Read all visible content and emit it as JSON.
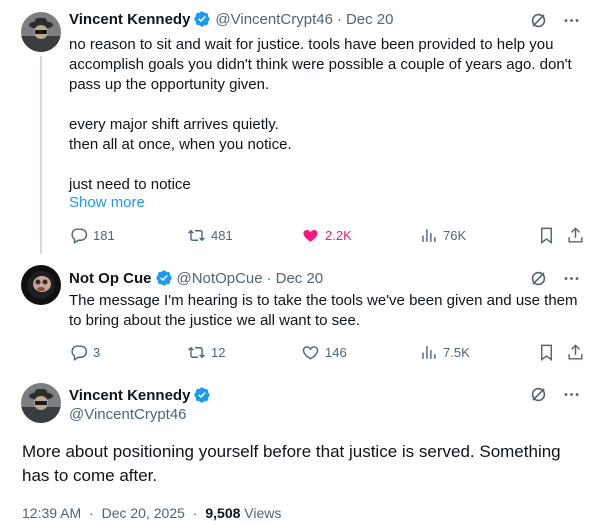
{
  "post1": {
    "name": "Vincent Kennedy",
    "handle": "@VincentCrypt46",
    "separator": "·",
    "date": "Dec 20",
    "text": "no reason to sit and wait for justice. tools have been provided to help you\naccomplish goals you didn't think were possible a couple of years ago. don't\npass up the opportunity given.\n\nevery major shift arrives quietly.\nthen all at once, when you notice.\n\njust need to notice",
    "show_more": "Show more",
    "replies": "181",
    "reposts": "481",
    "likes": "2.2K",
    "views": "76K",
    "like_color": "#f91880"
  },
  "post2": {
    "name": "Not Op Cue",
    "handle": "@NotOpCue",
    "separator": "·",
    "date": "Dec 20",
    "text": "The message I'm hearing is to take the tools we've been given and use them\nto bring about the justice we all want to see.",
    "replies": "3",
    "reposts": "12",
    "likes": "146",
    "views": "7.5K"
  },
  "main": {
    "name": "Vincent Kennedy",
    "handle": "@VincentCrypt46",
    "text": "More about positioning yourself before that justice is served. Something has to come after.",
    "time": "12:39 AM",
    "separator": "·",
    "date": "Dec 20, 2025",
    "views_count": "9,508",
    "views_label": "Views"
  },
  "colors": {
    "accent": "#1d9bf0",
    "verified": "#1d9bf0",
    "like": "#f91880",
    "muted": "#536471"
  },
  "icons": [
    "grok-icon",
    "more-icon",
    "reply-icon",
    "repost-icon",
    "like-icon",
    "views-icon",
    "bookmark-icon",
    "share-icon",
    "verified-badge-icon"
  ]
}
